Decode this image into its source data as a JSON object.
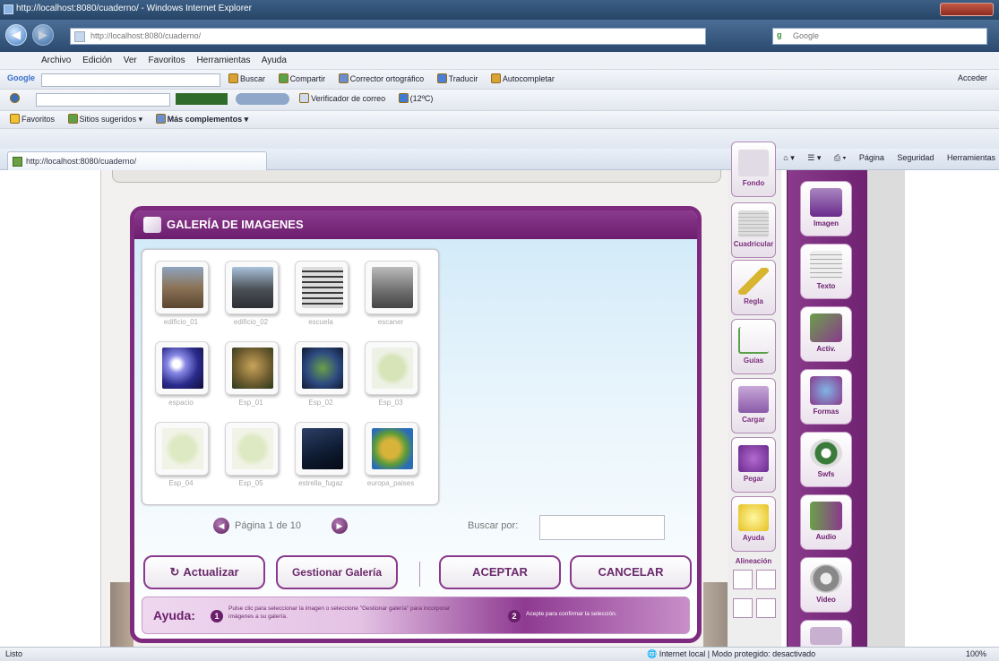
{
  "window": {
    "title": "http://localhost:8080/cuaderno/ - Windows Internet Explorer",
    "address": "http://localhost:8080/cuaderno/",
    "search_placeholder": "Google"
  },
  "menubar": [
    "Archivo",
    "Edición",
    "Ver",
    "Favoritos",
    "Herramientas",
    "Ayuda"
  ],
  "google_toolbar": {
    "label": "Google",
    "items": [
      "Buscar",
      "Compartir",
      "Corrector ortográfico",
      "Traducir",
      "Autocompletar"
    ],
    "right": "Acceder"
  },
  "toolbar2": {
    "items": [
      "Verificador de correo",
      "(12ºC)"
    ]
  },
  "favorites_bar": {
    "favorites": "Favoritos",
    "suggested": "Sitios sugeridos",
    "more": "Más complementos"
  },
  "tab": {
    "label": "http://localhost:8080/cuaderno/"
  },
  "command_bar": [
    "Página",
    "Seguridad",
    "Herramientas"
  ],
  "dialog": {
    "title": "GALERÍA DE IMAGENES",
    "thumbnails": [
      {
        "caption": "edificio_01",
        "color": "#8b7357"
      },
      {
        "caption": "edificio_02",
        "color": "#4a4f55"
      },
      {
        "caption": "escuela",
        "color": "#dcdcdc"
      },
      {
        "caption": "escaner",
        "color": "#6d6d6d"
      },
      {
        "caption": "espacio",
        "color": "#2a2a8c"
      },
      {
        "caption": "Esp_01",
        "color": "#6b5a2e"
      },
      {
        "caption": "Esp_02",
        "color": "#2d4a80"
      },
      {
        "caption": "Esp_03",
        "color": "#eef2e6"
      },
      {
        "caption": "Esp_04",
        "color": "#f0f3e6"
      },
      {
        "caption": "Esp_05",
        "color": "#f0f3e6"
      },
      {
        "caption": "estrella_fugaz",
        "color": "#0d1a30"
      },
      {
        "caption": "europa_paises",
        "color": "#2b6db5"
      }
    ],
    "pager": {
      "text": "Página 1 de 10"
    },
    "search_label": "Buscar por:",
    "search_value": "",
    "buttons": {
      "refresh": "Actualizar",
      "manage": "Gestionar Galería",
      "accept": "ACEPTAR",
      "cancel": "CANCELAR"
    },
    "help": {
      "label": "Ayuda:",
      "step1_num": "1",
      "step1": "Pulse clic para seleccionar la imagen o seleccione \"Gestionar galería\" para incorporar imágenes a su galería.",
      "step2_num": "2",
      "step2": "Acepte para confirmar la selección."
    }
  },
  "inner_tools": [
    "Fondo",
    "Cuadricular",
    "Regla",
    "Guías",
    "Cargar",
    "Pegar",
    "Ayuda"
  ],
  "inner_section": "Alineación",
  "outer_tools": [
    "Imagen",
    "Texto",
    "Activ.",
    "Formas",
    "Swfs",
    "Audio",
    "Video"
  ],
  "status": {
    "left": "Listo",
    "zone": "Internet local | Modo protegido: desactivado",
    "zoom": "100%"
  }
}
